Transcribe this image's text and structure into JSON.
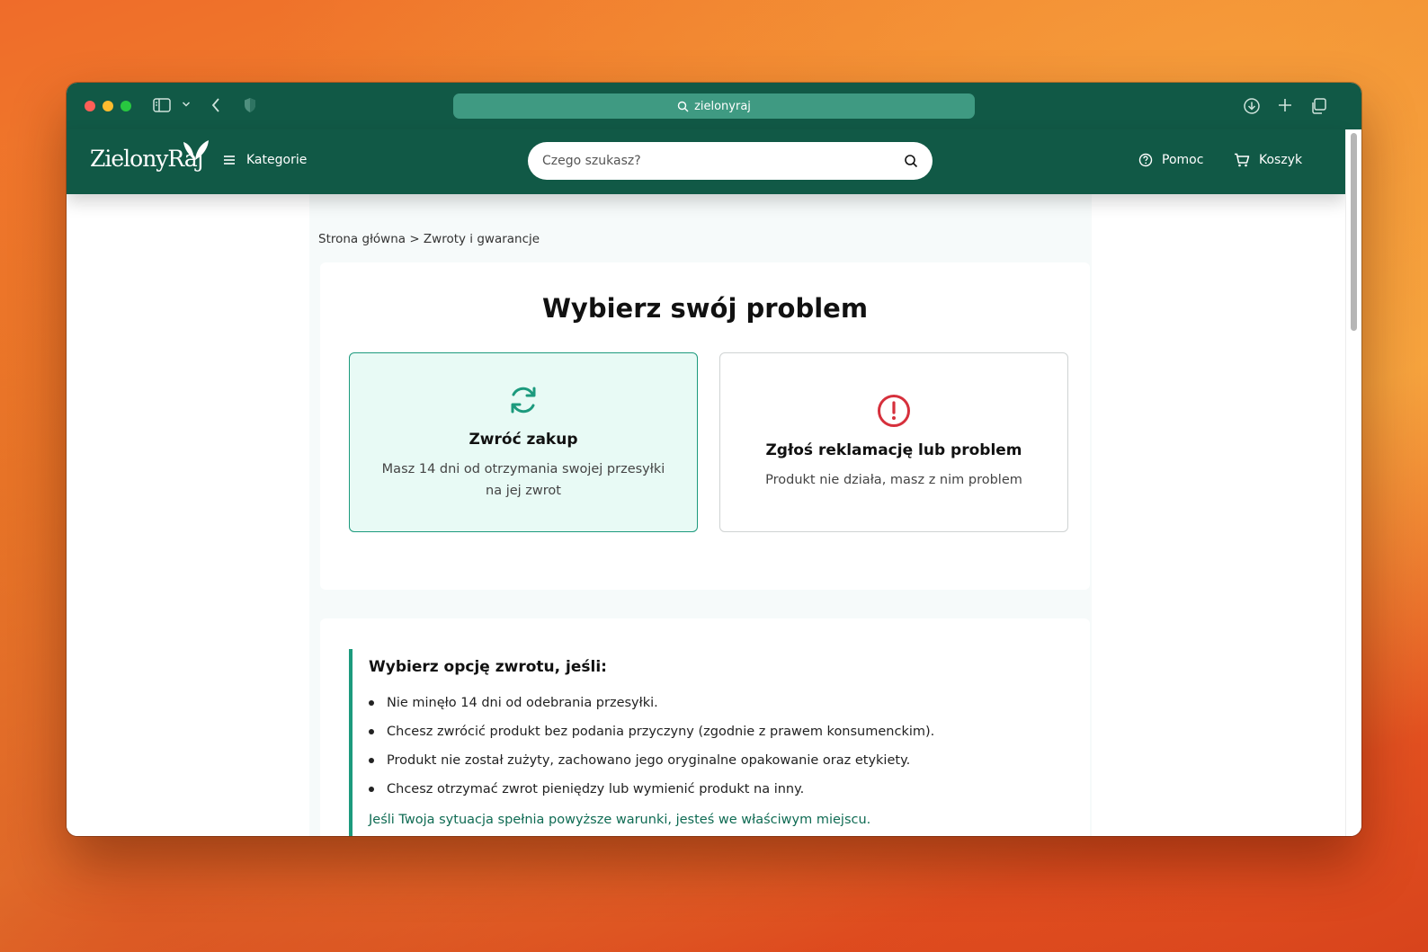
{
  "browser": {
    "url_text": "zielonyraj",
    "icons": [
      "sidebar-icon",
      "chevron-down-icon",
      "back-icon",
      "shield-icon",
      "download-icon",
      "plus-icon",
      "tabs-icon"
    ]
  },
  "header": {
    "logo": "ZielonyRaj",
    "categories_label": "Kategorie",
    "search_placeholder": "Czego szukasz?",
    "help_label": "Pomoc",
    "cart_label": "Koszyk"
  },
  "breadcrumb": "Strona główna > Zwroty i gwarancje",
  "problem": {
    "title": "Wybierz swój problem",
    "cards": [
      {
        "title": "Zwróć zakup",
        "desc": "Masz 14 dni od otrzymania swojej przesyłki na jej zwrot",
        "icon": "refresh-icon",
        "selected": true
      },
      {
        "title": "Zgłoś reklamację lub problem",
        "desc": "Produkt nie działa, masz z nim problem",
        "icon": "alert-icon",
        "selected": false
      }
    ]
  },
  "info": {
    "title": "Wybierz opcję zwrotu, jeśli:",
    "items": [
      "Nie minęło 14 dni od odebrania przesyłki.",
      "Chcesz zwrócić produkt bez podania przyczyny (zgodnie z prawem konsumenckim).",
      "Produkt nie został zużyty, zachowano jego oryginalne opakowanie oraz etykiety.",
      "Chcesz otrzymać zwrot pieniędzy lub wymienić produkt na inny."
    ],
    "note": "Jeśli Twoja sytuacja spełnia powyższe warunki, jesteś we właściwym miejscu."
  },
  "colors": {
    "brand_green": "#115946",
    "accent_teal": "#1c9a7d",
    "alert_red": "#d6303c"
  }
}
